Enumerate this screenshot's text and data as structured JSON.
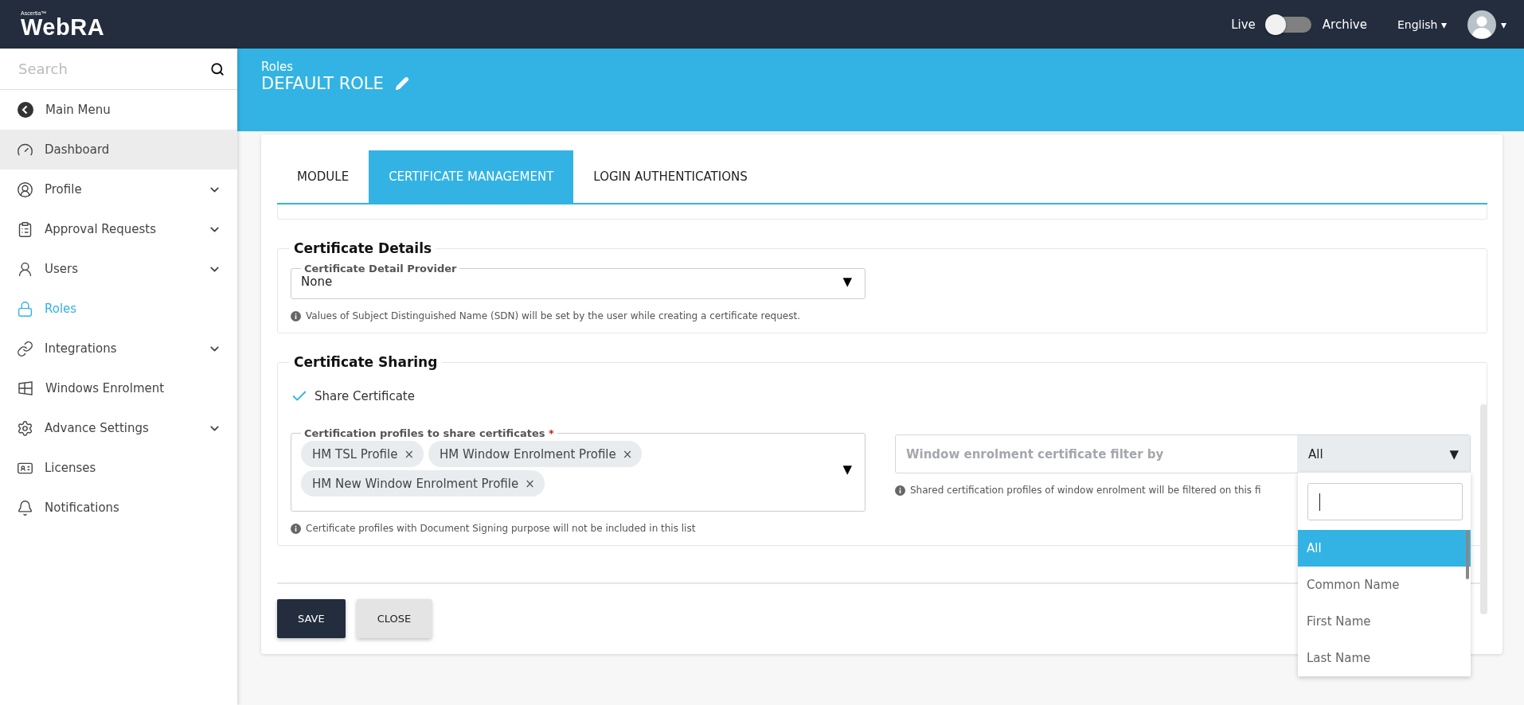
{
  "header": {
    "logo": {
      "brand": "Ascertia™",
      "name": "WebRA"
    },
    "mode_toggle": {
      "left_label": "Live",
      "right_label": "Archive",
      "on": false
    },
    "language": {
      "label": "English",
      "caret": "▾"
    },
    "user_menu": {
      "caret": "▾"
    }
  },
  "sidebar": {
    "search": {
      "placeholder": "Search"
    },
    "items": [
      {
        "label": "Main Menu",
        "expandable": false,
        "selected": false,
        "hovered": false
      },
      {
        "label": "Dashboard",
        "expandable": false,
        "selected": false,
        "hovered": true
      },
      {
        "label": "Profile",
        "expandable": true,
        "selected": false,
        "hovered": false
      },
      {
        "label": "Approval Requests",
        "expandable": true,
        "selected": false,
        "hovered": false
      },
      {
        "label": "Users",
        "expandable": true,
        "selected": false,
        "hovered": false
      },
      {
        "label": "Roles",
        "expandable": false,
        "selected": true,
        "hovered": false
      },
      {
        "label": "Integrations",
        "expandable": true,
        "selected": false,
        "hovered": false
      },
      {
        "label": "Windows Enrolment",
        "expandable": false,
        "selected": false,
        "hovered": false
      },
      {
        "label": "Advance Settings",
        "expandable": true,
        "selected": false,
        "hovered": false
      },
      {
        "label": "Licenses",
        "expandable": false,
        "selected": false,
        "hovered": false
      },
      {
        "label": "Notifications",
        "expandable": false,
        "selected": false,
        "hovered": false
      }
    ]
  },
  "page": {
    "breadcrumb": "Roles",
    "title": "DEFAULT ROLE"
  },
  "tabs": [
    {
      "label": "MODULE",
      "selected": false
    },
    {
      "label": "CERTIFICATE MANAGEMENT",
      "selected": true
    },
    {
      "label": "LOGIN AUTHENTICATIONS",
      "selected": false
    }
  ],
  "certificate_details": {
    "title": "Certificate Details",
    "provider": {
      "label": "Certificate Detail Provider",
      "value": "None",
      "caret": "▼"
    },
    "help": "Values of Subject Distinguished Name (SDN) will be set by the user while creating a certificate request."
  },
  "certificate_sharing": {
    "title": "Certificate Sharing",
    "share": {
      "label": "Share Certificate",
      "checked": true
    },
    "profiles": {
      "label": "Certification profiles to share certificates",
      "required_mark": "*",
      "caret": "▼",
      "chips": [
        {
          "label": "HM TSL Profile",
          "remove": "×"
        },
        {
          "label": "HM Window Enrolment Profile",
          "remove": "×"
        },
        {
          "label": "HM New Window Enrolment Profile",
          "remove": "×"
        }
      ],
      "help": "Certificate profiles with Document Signing purpose will not be included in this list"
    },
    "filter": {
      "label": "Window enrolment certificate filter by",
      "value": "All",
      "caret": "▼",
      "help": "Shared certification profiles of window enrolment will be filtered on this fi",
      "dropdown": {
        "options": [
          {
            "label": "All",
            "selected": true
          },
          {
            "label": "Common Name",
            "selected": false
          },
          {
            "label": "First Name",
            "selected": false
          },
          {
            "label": "Last Name",
            "selected": false
          }
        ]
      }
    }
  },
  "buttons": [
    {
      "label": "SAVE",
      "kind": "primary"
    },
    {
      "label": "CLOSE",
      "kind": "secondary"
    }
  ]
}
